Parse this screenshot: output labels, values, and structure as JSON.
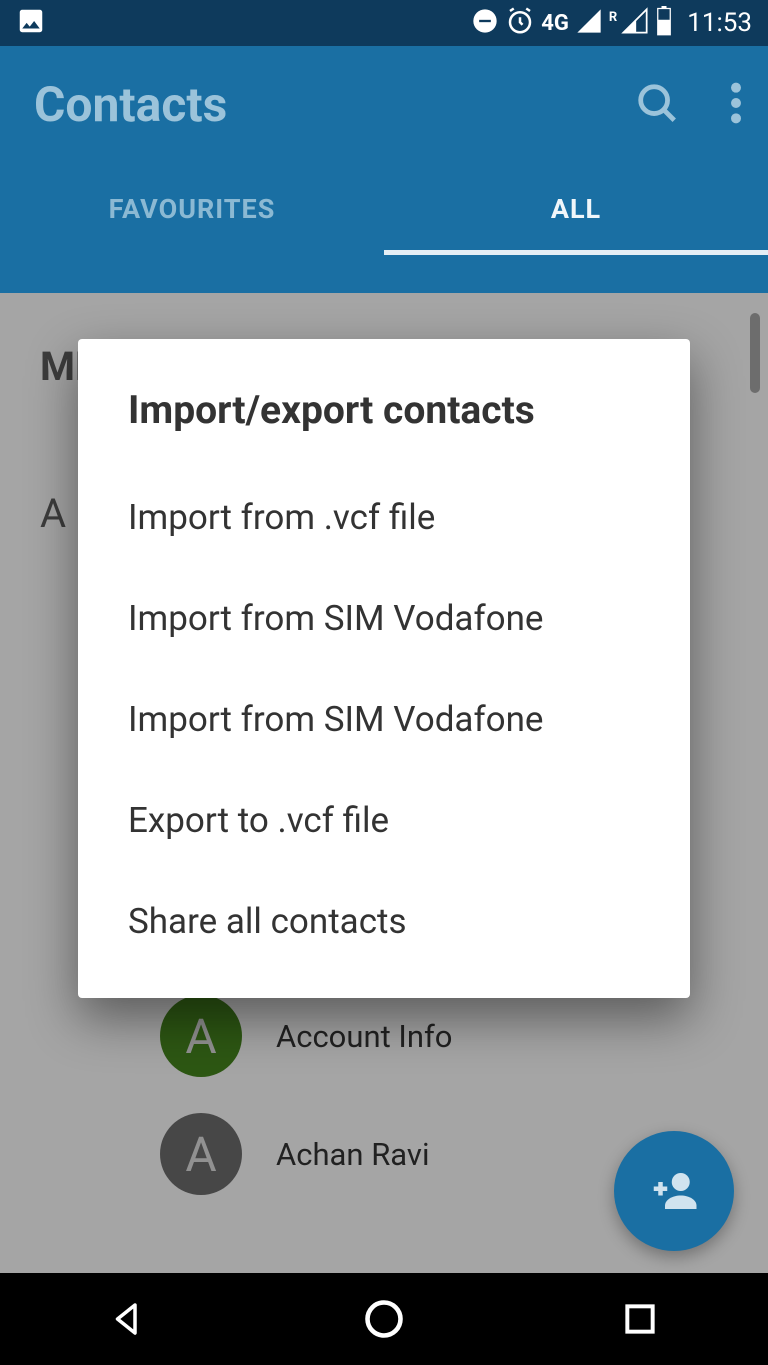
{
  "statusbar": {
    "network_type": "4G",
    "roaming": "R",
    "time": "11:53"
  },
  "appbar": {
    "title": "Contacts"
  },
  "tabs": {
    "favourites": "FAVOURITES",
    "all": "ALL"
  },
  "sections": {
    "me": "ME",
    "a": "A"
  },
  "contacts": [
    {
      "initial": "A",
      "name": "Account Info",
      "avatar_color": "green"
    },
    {
      "initial": "A",
      "name": "Achan Ravi",
      "avatar_color": "gray"
    }
  ],
  "dialog": {
    "title": "Import/export contacts",
    "options": [
      "Import from .vcf file",
      "Import from SIM Vodafone",
      "Import from SIM Vodafone",
      "Export to .vcf file",
      "Share all contacts"
    ]
  },
  "colors": {
    "primary": "#1a6fa3",
    "status_bg": "#0e3a5c",
    "avatar_green": "#45841d",
    "avatar_gray": "#6d6d6d"
  }
}
